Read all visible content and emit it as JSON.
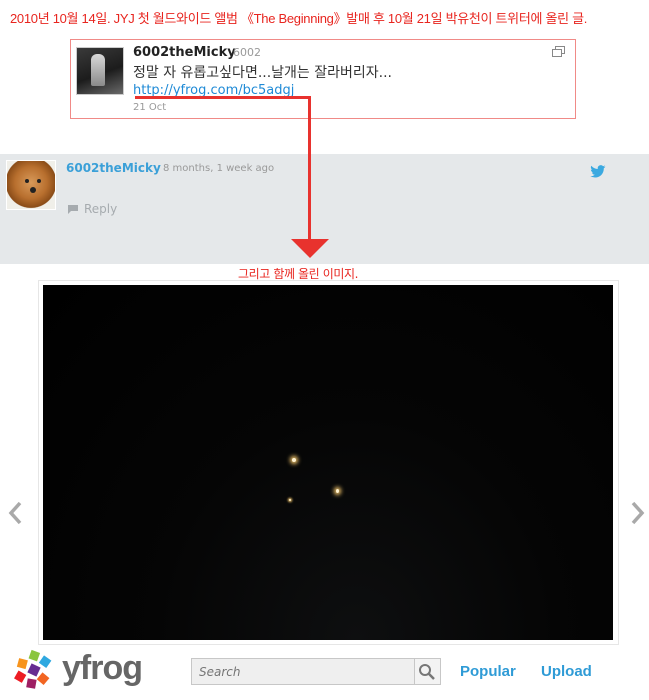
{
  "caption_top": "2010년 10월 14일. JYJ 첫 월드와이드 앨범 《The Beginning》발매 후 10월 21일 박유천이 트위터에 올린 글.",
  "tweet": {
    "name": "6002theMicky",
    "handle": "6002",
    "text": "정말 자 유롭고싶다면...날개는 잘라버리자...",
    "link": "http://yfrog.com/bc5adgj",
    "date": "21 Oct"
  },
  "comment": {
    "name": "6002theMicky",
    "time": "8 months, 1 week ago",
    "reply_label": "Reply"
  },
  "caption_mid": "그리고 함께 올린 이미지.",
  "footer": {
    "logo_text": "yfrog",
    "search_placeholder": "Search",
    "popular_label": "Popular",
    "upload_label": "Upload"
  },
  "colors": {
    "caption_red": "#e8251f",
    "link_blue": "#2f9bd6",
    "band_gray": "#e5e8ea"
  }
}
